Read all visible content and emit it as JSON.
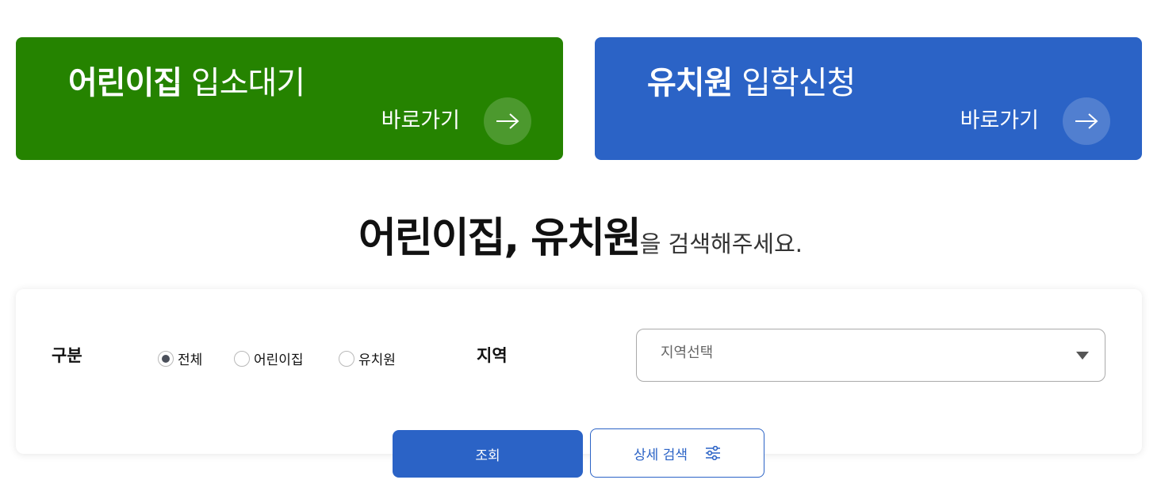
{
  "banners": {
    "daycare": {
      "title_strong": "어린이집",
      "title_light": "입소대기",
      "link_label": "바로가기",
      "color": "#258300",
      "icon": "arrow-right-icon"
    },
    "kindergarten": {
      "title_strong": "유치원",
      "title_light": "입학신청",
      "link_label": "바로가기",
      "color": "#2b63c6",
      "icon": "arrow-right-icon"
    }
  },
  "headline": {
    "bold": "어린이집, 유치원",
    "light": "을 검색해주세요."
  },
  "search": {
    "category_label": "구분",
    "options": [
      {
        "label": "전체",
        "selected": true
      },
      {
        "label": "어린이집",
        "selected": false
      },
      {
        "label": "유치원",
        "selected": false
      }
    ],
    "region_label": "지역",
    "region_placeholder": "지역선택"
  },
  "buttons": {
    "search_label": "조회",
    "advanced_label": "상세 검색",
    "advanced_icon": "filter-sliders-icon"
  },
  "colors": {
    "green": "#258300",
    "blue": "#2b63c6"
  }
}
